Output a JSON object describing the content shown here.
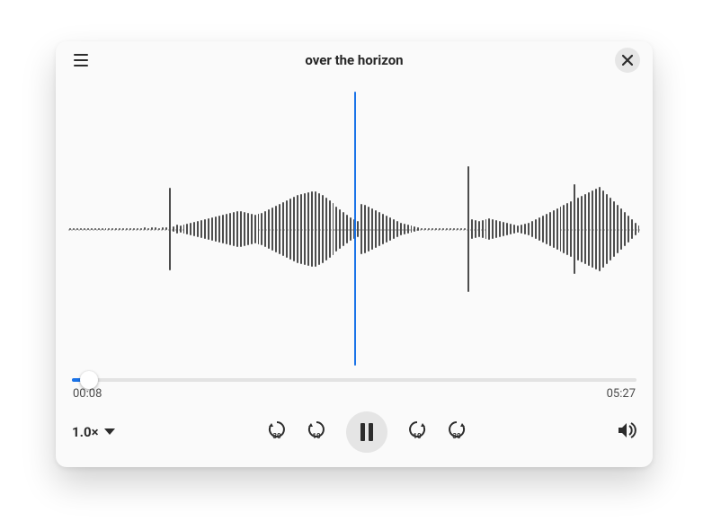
{
  "colors": {
    "accent": "#1a73e8"
  },
  "header": {
    "title": "over the horizon"
  },
  "playback": {
    "elapsed": "00:08",
    "total": "05:27",
    "progress_pct": 3.1,
    "playhead_pct": 50,
    "speed_label": "1.0×"
  },
  "icons": {
    "menu": "menu-icon",
    "close": "close-icon",
    "back30": "replay-30-icon",
    "back10": "replay-10-icon",
    "pause": "pause-icon",
    "fwd10": "forward-10-icon",
    "fwd30": "forward-30-icon",
    "volume": "volume-high-icon",
    "chevron": "chevron-down-icon"
  },
  "waveform": {
    "bars": [
      0,
      0,
      0,
      0,
      0,
      0,
      0,
      0,
      0,
      0,
      0,
      0,
      0,
      0,
      0,
      0,
      0,
      0,
      0,
      0,
      2,
      3,
      2,
      3,
      3,
      2,
      3,
      3,
      92,
      6,
      10,
      8,
      10,
      12,
      14,
      16,
      18,
      20,
      22,
      24,
      26,
      28,
      30,
      32,
      34,
      36,
      38,
      40,
      40,
      38,
      36,
      34,
      32,
      34,
      36,
      40,
      44,
      48,
      52,
      56,
      60,
      64,
      68,
      72,
      76,
      78,
      80,
      82,
      84,
      84,
      80,
      76,
      70,
      64,
      58,
      50,
      44,
      38,
      32,
      26,
      22,
      18,
      56,
      54,
      50,
      46,
      42,
      38,
      34,
      30,
      26,
      22,
      18,
      14,
      12,
      10,
      8,
      6,
      4,
      0,
      0,
      0,
      0,
      0,
      0,
      0,
      0,
      0,
      0,
      0,
      0,
      0,
      140,
      22,
      20,
      18,
      20,
      22,
      24,
      22,
      20,
      18,
      16,
      14,
      12,
      10,
      8,
      10,
      12,
      14,
      18,
      22,
      26,
      30,
      34,
      38,
      42,
      46,
      50,
      54,
      58,
      62,
      100,
      70,
      74,
      78,
      82,
      86,
      90,
      94,
      86,
      78,
      70,
      62,
      54,
      46,
      38,
      30,
      22,
      14,
      8
    ]
  }
}
